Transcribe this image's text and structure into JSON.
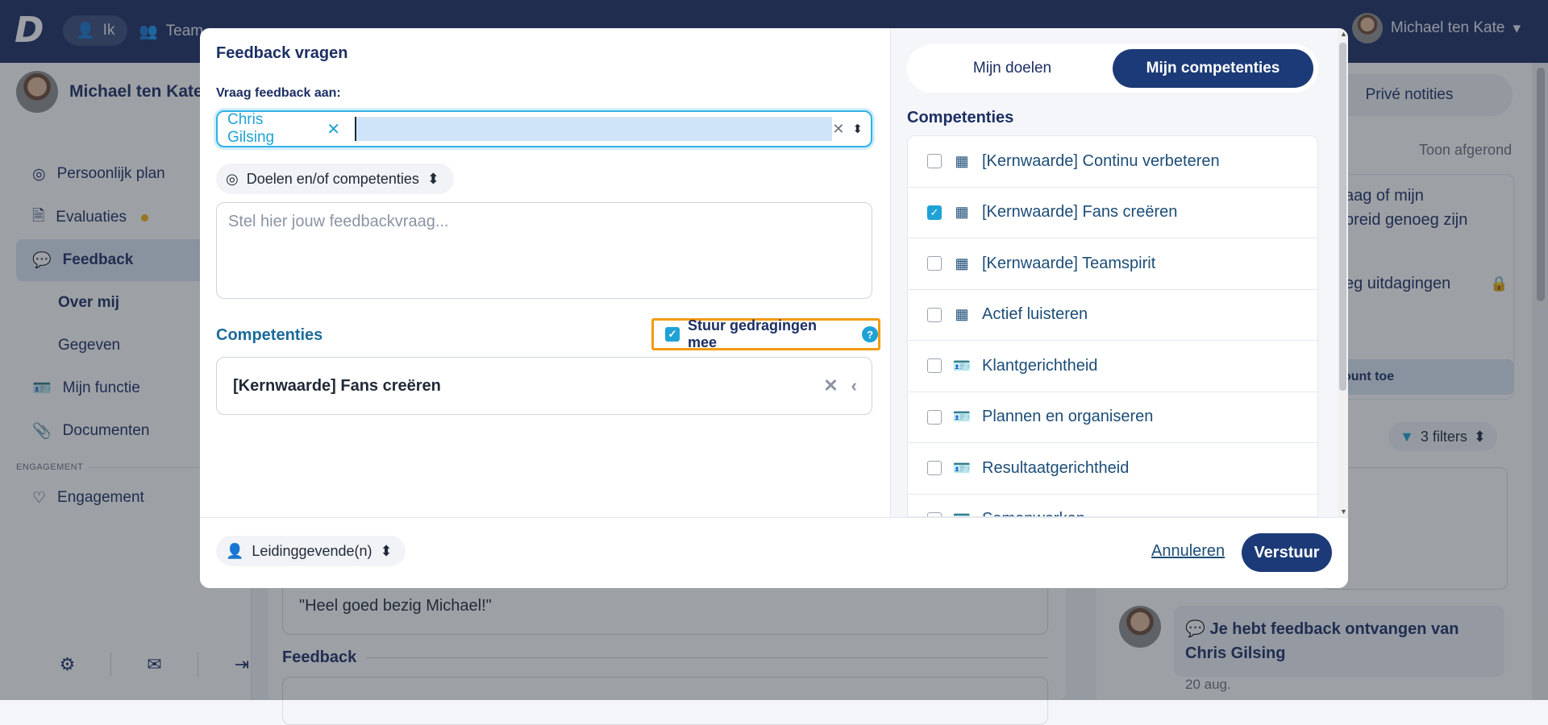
{
  "topbar": {
    "logo": "D",
    "ik_label": "Ik",
    "team_label": "Team",
    "user_name": "Michael ten Kate"
  },
  "sidebar": {
    "user_name": "Michael ten Kate",
    "items": [
      {
        "label": "Persoonlijk plan",
        "icon": "target-icon"
      },
      {
        "label": "Evaluaties",
        "icon": "document-icon"
      },
      {
        "label": "Feedback",
        "icon": "chat-icon"
      },
      {
        "label": "Over mij"
      },
      {
        "label": "Gegeven"
      },
      {
        "label": "Mijn functie",
        "icon": "id-card-icon"
      },
      {
        "label": "Documenten",
        "icon": "paperclip-icon"
      },
      {
        "label": "Engagement",
        "icon": "heart-pulse-icon"
      }
    ],
    "section_engagement": "ENGAGEMENT"
  },
  "main": {
    "quote": "\"Heel goed bezig Michael!\"",
    "feedback_heading": "Feedback"
  },
  "right_panel": {
    "prive_tab": "Privé notities",
    "toon_afgerond": "Toon afgerond",
    "card_text_line1": "aag of mijn",
    "card_text_line2": "breid genoeg zijn",
    "card_text_2": "eg uitdagingen",
    "card_button": "ount toe",
    "filters": "3 filters",
    "notification": "Je hebt feedback ontvangen van Chris Gilsing",
    "notification_date": "20 aug."
  },
  "modal": {
    "title": "Feedback vragen",
    "ask_label": "Vraag feedback aan:",
    "selected_person": "Chris Gilsing",
    "goals_dropdown": "Doelen en/of competenties",
    "textarea_placeholder": "Stel hier jouw feedbackvraag...",
    "competenties_label": "Competenties",
    "stuur_gedragingen": "Stuur gedragingen mee",
    "selected_competence": "[Kernwaarde] Fans creëren",
    "tabs": [
      "Mijn doelen",
      "Mijn competenties"
    ],
    "right_title": "Competenties",
    "competence_list": [
      {
        "label": "[Kernwaarde] Continu verbeteren",
        "checked": false,
        "icon": "building-icon"
      },
      {
        "label": "[Kernwaarde] Fans creëren",
        "checked": true,
        "icon": "building-icon"
      },
      {
        "label": "[Kernwaarde] Teamspirit",
        "checked": false,
        "icon": "building-icon"
      },
      {
        "label": "Actief luisteren",
        "checked": false,
        "icon": "building-icon"
      },
      {
        "label": "Klantgerichtheid",
        "checked": false,
        "icon": "id-card-icon"
      },
      {
        "label": "Plannen en organiseren",
        "checked": false,
        "icon": "id-card-icon"
      },
      {
        "label": "Resultaatgerichtheid",
        "checked": false,
        "icon": "id-card-icon"
      },
      {
        "label": "Samenwerken",
        "checked": false,
        "icon": "id-card-icon"
      }
    ],
    "footer": {
      "recipient_dropdown": "Leidinggevende(n)",
      "cancel": "Annuleren",
      "submit": "Verstuur"
    }
  },
  "colors": {
    "navy": "#1c2f63",
    "accent": "#1fa2d6",
    "highlight": "#f29b11"
  }
}
